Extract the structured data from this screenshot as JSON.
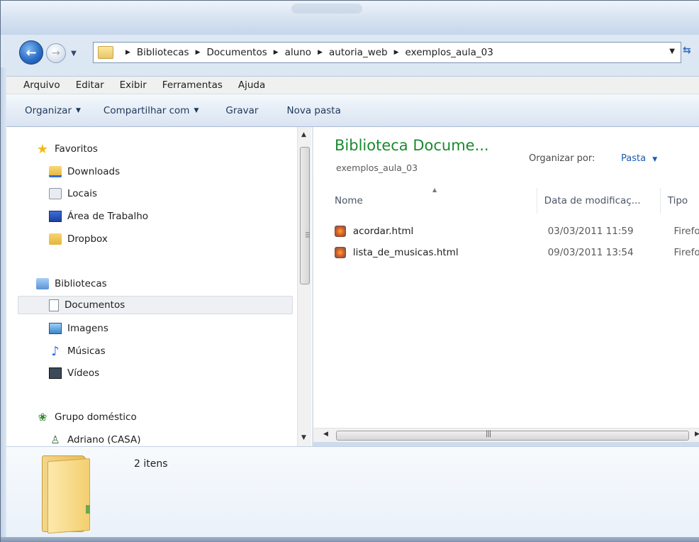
{
  "address": {
    "crumbs": [
      "Bibliotecas",
      "Documentos",
      "aluno",
      "autoria_web",
      "exemplos_aula_03"
    ]
  },
  "menu": [
    "Arquivo",
    "Editar",
    "Exibir",
    "Ferramentas",
    "Ajuda"
  ],
  "commands": {
    "organize": "Organizar",
    "share": "Compartilhar com",
    "burn": "Gravar",
    "new_folder": "Nova pasta"
  },
  "nav": {
    "favorites": "Favoritos",
    "downloads": "Downloads",
    "locals": "Locais",
    "desktop": "Área de Trabalho",
    "dropbox": "Dropbox",
    "libraries": "Bibliotecas",
    "documents": "Documentos",
    "images": "Imagens",
    "music": "Músicas",
    "videos": "Vídeos",
    "homegroup": "Grupo doméstico",
    "user": "Adriano (CASA)"
  },
  "content": {
    "title": "Biblioteca Docume...",
    "subtitle": "exemplos_aula_03",
    "arrange_label": "Organizar por:",
    "arrange_value": "Pasta",
    "columns": {
      "name": "Nome",
      "date": "Data de modificaç...",
      "type": "Tipo"
    },
    "files": [
      {
        "name": "acordar.html",
        "date": "03/03/2011 11:59",
        "type": "Firefox HTML Document"
      },
      {
        "name": "lista_de_musicas.html",
        "date": "09/03/2011 13:54",
        "type": "Firefox HTML Document"
      }
    ]
  },
  "details": {
    "count": "2 itens"
  },
  "icons": {
    "back": "back-arrow-icon",
    "forward": "forward-arrow-icon",
    "folder": "folder-icon",
    "firefox": "firefox-html-icon"
  }
}
